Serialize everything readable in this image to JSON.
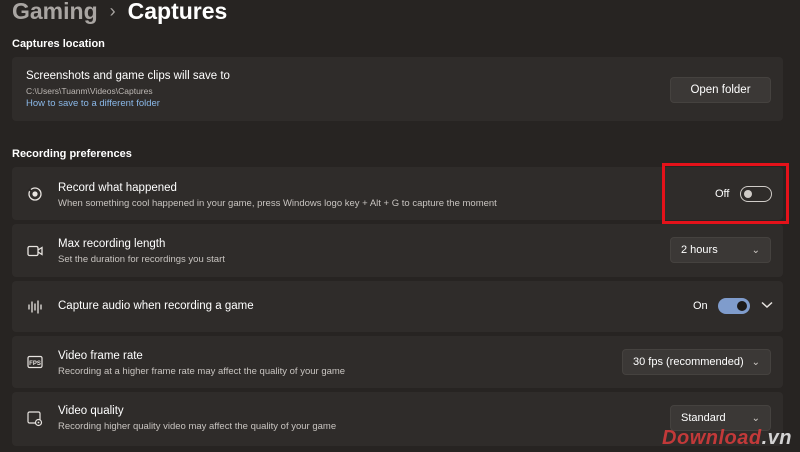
{
  "breadcrumb": {
    "parent": "Gaming",
    "separator": "›",
    "current": "Captures"
  },
  "captures_location": {
    "section_title": "Captures location",
    "title": "Screenshots and game clips will save to",
    "path": "C:\\Users\\Tuanm\\Videos\\Captures",
    "link": "How to save to a different folder",
    "button": "Open folder"
  },
  "recording": {
    "section_title": "Recording preferences",
    "record_what_happened": {
      "title": "Record what happened",
      "desc": "When something cool happened in your game, press Windows logo key + Alt + G to capture the moment",
      "state_label": "Off"
    },
    "max_length": {
      "title": "Max recording length",
      "desc": "Set the duration for recordings you start",
      "value": "2 hours"
    },
    "capture_audio": {
      "title": "Capture audio when recording a game",
      "state_label": "On"
    },
    "frame_rate": {
      "title": "Video frame rate",
      "desc": "Recording at a higher frame rate may affect the quality of your game",
      "value": "30 fps (recommended)"
    },
    "video_quality": {
      "title": "Video quality",
      "desc": "Recording higher quality video may affect the quality of your game",
      "value": "Standard"
    }
  },
  "icons": {
    "record": "record-icon",
    "timer": "video-camera-icon",
    "audio": "audio-wave-icon",
    "fps": "fps-icon",
    "quality": "video-settings-icon"
  },
  "colors": {
    "highlight": "#e4121a",
    "toggle_on": "#7f9ccc",
    "link": "#8ab8e8"
  },
  "watermark": {
    "text": "Download",
    "tld": ".vn"
  }
}
